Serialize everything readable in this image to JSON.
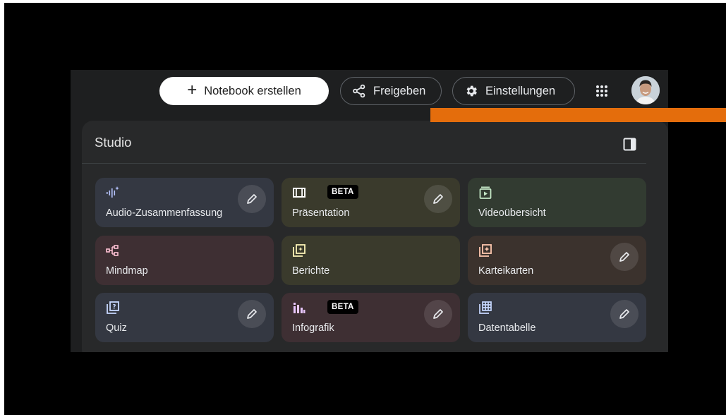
{
  "topbar": {
    "create_label": "Notebook erstellen",
    "share_label": "Freigeben",
    "settings_label": "Einstellungen"
  },
  "studio": {
    "title": "Studio",
    "cards": [
      {
        "label": "Audio-Zusammenfassung",
        "icon": "audio-waveform-icon",
        "color": "#343842",
        "editable": true
      },
      {
        "label": "Präsentation",
        "icon": "slides-icon",
        "color": "#3a3a2c",
        "badge": "BETA",
        "editable": true
      },
      {
        "label": "Videoübersicht",
        "icon": "video-overview-icon",
        "color": "#323b31",
        "editable": false
      },
      {
        "label": "Mindmap",
        "icon": "mindmap-icon",
        "color": "#3e2f33",
        "editable": false
      },
      {
        "label": "Berichte",
        "icon": "reports-icon",
        "color": "#3a3a2c",
        "editable": false
      },
      {
        "label": "Karteikarten",
        "icon": "flashcards-icon",
        "color": "#3b322d",
        "editable": true
      },
      {
        "label": "Quiz",
        "icon": "quiz-icon",
        "color": "#343842",
        "editable": true
      },
      {
        "label": "Infografik",
        "icon": "infographic-icon",
        "color": "#3e2f33",
        "badge": "BETA",
        "editable": true
      },
      {
        "label": "Datentabelle",
        "icon": "data-table-icon",
        "color": "#343842",
        "editable": true
      }
    ]
  },
  "colors": {
    "background": "#000000",
    "app": "#1e1f20",
    "panel": "#28292a",
    "accent_line": "#e46d0c",
    "audio_icon": "#b7c5ff",
    "slides_icon": "#ffffff",
    "video_icon": "#c4e7c6",
    "mindmap_icon": "#ffc1d4",
    "reports_icon": "#fbf3b6",
    "flashcards_icon": "#ffc8b0",
    "quiz_icon": "#c7d8ff",
    "infographic_icon": "#e8c7ff",
    "datatable_icon": "#c7d8ff"
  }
}
